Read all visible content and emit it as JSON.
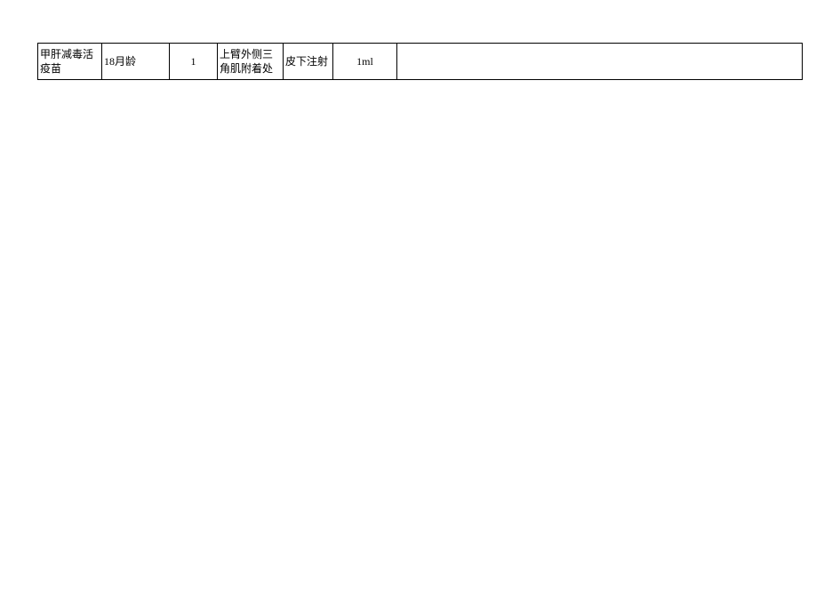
{
  "table": {
    "rows": [
      {
        "vaccine": "甲肝减毒活疫苗",
        "age": "18月龄",
        "dose_no": "1",
        "site": "上臂外侧三角肌附着处",
        "method": "皮下注射",
        "amount": "1ml",
        "remark": ""
      }
    ]
  }
}
